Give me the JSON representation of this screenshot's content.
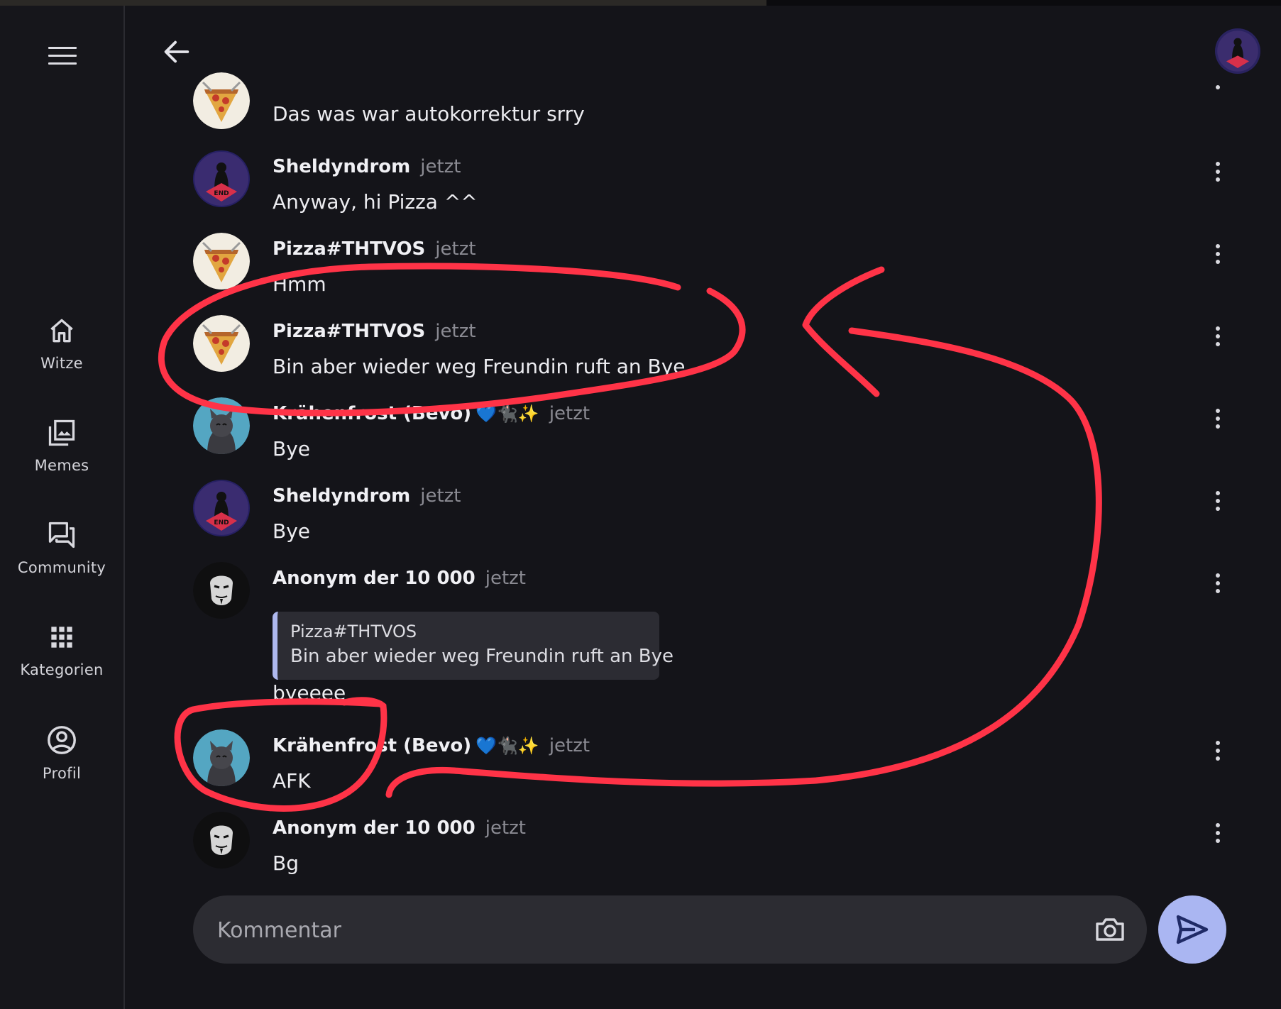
{
  "sidebar": {
    "menu_icon": "hamburger-menu-icon",
    "items": [
      {
        "label": "Witze",
        "icon": "home-icon"
      },
      {
        "label": "Memes",
        "icon": "image-library-icon"
      },
      {
        "label": "Community",
        "icon": "forum-icon"
      },
      {
        "label": "Kategorien",
        "icon": "grid-icon"
      },
      {
        "label": "Profil",
        "icon": "account-circle-icon"
      }
    ]
  },
  "header": {
    "back_icon": "arrow-back-icon",
    "avatar": "user-avatar"
  },
  "messages": [
    {
      "author": "",
      "time": "",
      "text": "Das was war autokorrektur srry",
      "avatar": "pizza"
    },
    {
      "author": "Sheldyndrom",
      "time": "jetzt",
      "text": "Anyway, hi Pizza ^^",
      "avatar": "end"
    },
    {
      "author": "Pizza#THTVOS",
      "time": "jetzt",
      "text": "Hmm",
      "avatar": "pizza"
    },
    {
      "author": "Pizza#THTVOS",
      "time": "jetzt",
      "text": "Bin aber wieder weg Freundin ruft an Bye",
      "avatar": "pizza"
    },
    {
      "author": "Krähenfrost (Bevo)",
      "emoji": "💙🐈‍⬛✨",
      "time": "jetzt",
      "text": "Bye",
      "avatar": "cat"
    },
    {
      "author": "Sheldyndrom",
      "time": "jetzt",
      "text": "Bye",
      "avatar": "end"
    },
    {
      "author": "Anonym der 10 000",
      "time": "jetzt",
      "quote": {
        "author": "Pizza#THTVOS",
        "text": "Bin aber wieder weg Freundin ruft an Bye"
      },
      "text": "byeeee",
      "avatar": "mask"
    },
    {
      "author": "Krähenfrost (Bevo)",
      "emoji": "💙🐈‍⬛✨",
      "time": "jetzt",
      "text": "AFK",
      "avatar": "cat"
    },
    {
      "author": "Anonym der 10 000",
      "time": "jetzt",
      "text": "Bg",
      "avatar": "mask"
    }
  ],
  "composer": {
    "placeholder": "Kommentar",
    "value": "",
    "camera_icon": "camera-icon",
    "send_icon": "send-icon"
  },
  "colors": {
    "background": "#141419",
    "sidebar": "#16161b",
    "accent": "#aab6f2",
    "annotation": "#ff3347"
  }
}
